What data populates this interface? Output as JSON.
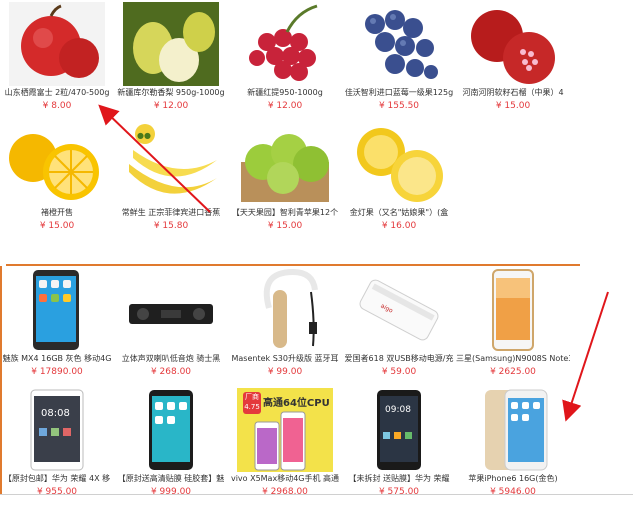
{
  "fruits": [
    {
      "name": "山东栖霞富士 2粒/470-500g",
      "price": "¥ 8.00",
      "icon": "apple-image"
    },
    {
      "name": "新疆库尔勒香梨 950g-1000g",
      "price": "¥ 12.00",
      "icon": "pear-image"
    },
    {
      "name": "新疆红提950-1000g",
      "price": "¥ 12.00",
      "icon": "grapes-image"
    },
    {
      "name": "佳沃智利进口蓝莓一级果125g",
      "price": "¥ 155.50",
      "icon": "blueberry-image"
    },
    {
      "name": "河南河阴软籽石榴（中果）4",
      "price": "¥ 15.00",
      "icon": "pomegranate-image"
    },
    {
      "name": "褚橙开售",
      "price": "¥ 15.00",
      "icon": "orange-image"
    },
    {
      "name": "常鲜生 正宗菲律宾进口香蕉",
      "price": "¥ 15.80",
      "icon": "banana-image"
    },
    {
      "name": "【天天果园】智利青苹果12个",
      "price": "¥ 15.00",
      "icon": "green-apple-image"
    },
    {
      "name": "金灯果（又名\"姑娘果\"）(盒",
      "price": "¥ 16.00",
      "icon": "lemon-image"
    }
  ],
  "electronics": [
    {
      "name": "魅族 MX4 16GB 灰色 移动4G",
      "price": "¥ 17890.00",
      "icon": "meizu-phone-image"
    },
    {
      "name": "立体声双喇叭低音炮 骑士黑",
      "price": "¥ 268.00",
      "icon": "speaker-image"
    },
    {
      "name": "Masentek S30升级版 蓝牙耳",
      "price": "¥ 99.00",
      "icon": "bluetooth-headset-image"
    },
    {
      "name": "爱国者618 双USB移动电源/充",
      "price": "¥ 59.00",
      "icon": "power-bank-image"
    },
    {
      "name": "三星(Samsung)N9008S Note3",
      "price": "¥ 2625.00",
      "icon": "samsung-phone-image"
    },
    {
      "name": "【原封包邮】华为 荣耀 4X 移",
      "price": "¥ 955.00",
      "icon": "huawei-phone-image"
    },
    {
      "name": "【原封送高清贴膜 硅胶套】魅",
      "price": "¥ 999.00",
      "icon": "meizu-blue-phone-image"
    },
    {
      "name": "vivo X5Max移动4G手机 高通",
      "price": "¥ 2968.00",
      "icon": "vivo-phone-image",
      "badge_top": "厂商",
      "badge_bottom": "4.75",
      "banner": "高通64位CPU"
    },
    {
      "name": "【未拆封 送贴膜】华为 荣耀",
      "price": "¥ 575.00",
      "icon": "honor-phone-image"
    },
    {
      "name": "苹果iPhone6 16G(金色)",
      "price": "¥ 5946.00",
      "icon": "iphone-image"
    }
  ],
  "colors": {
    "price": "#e4393c",
    "accent": "#e07a2e",
    "annotation": "#e0161b"
  }
}
